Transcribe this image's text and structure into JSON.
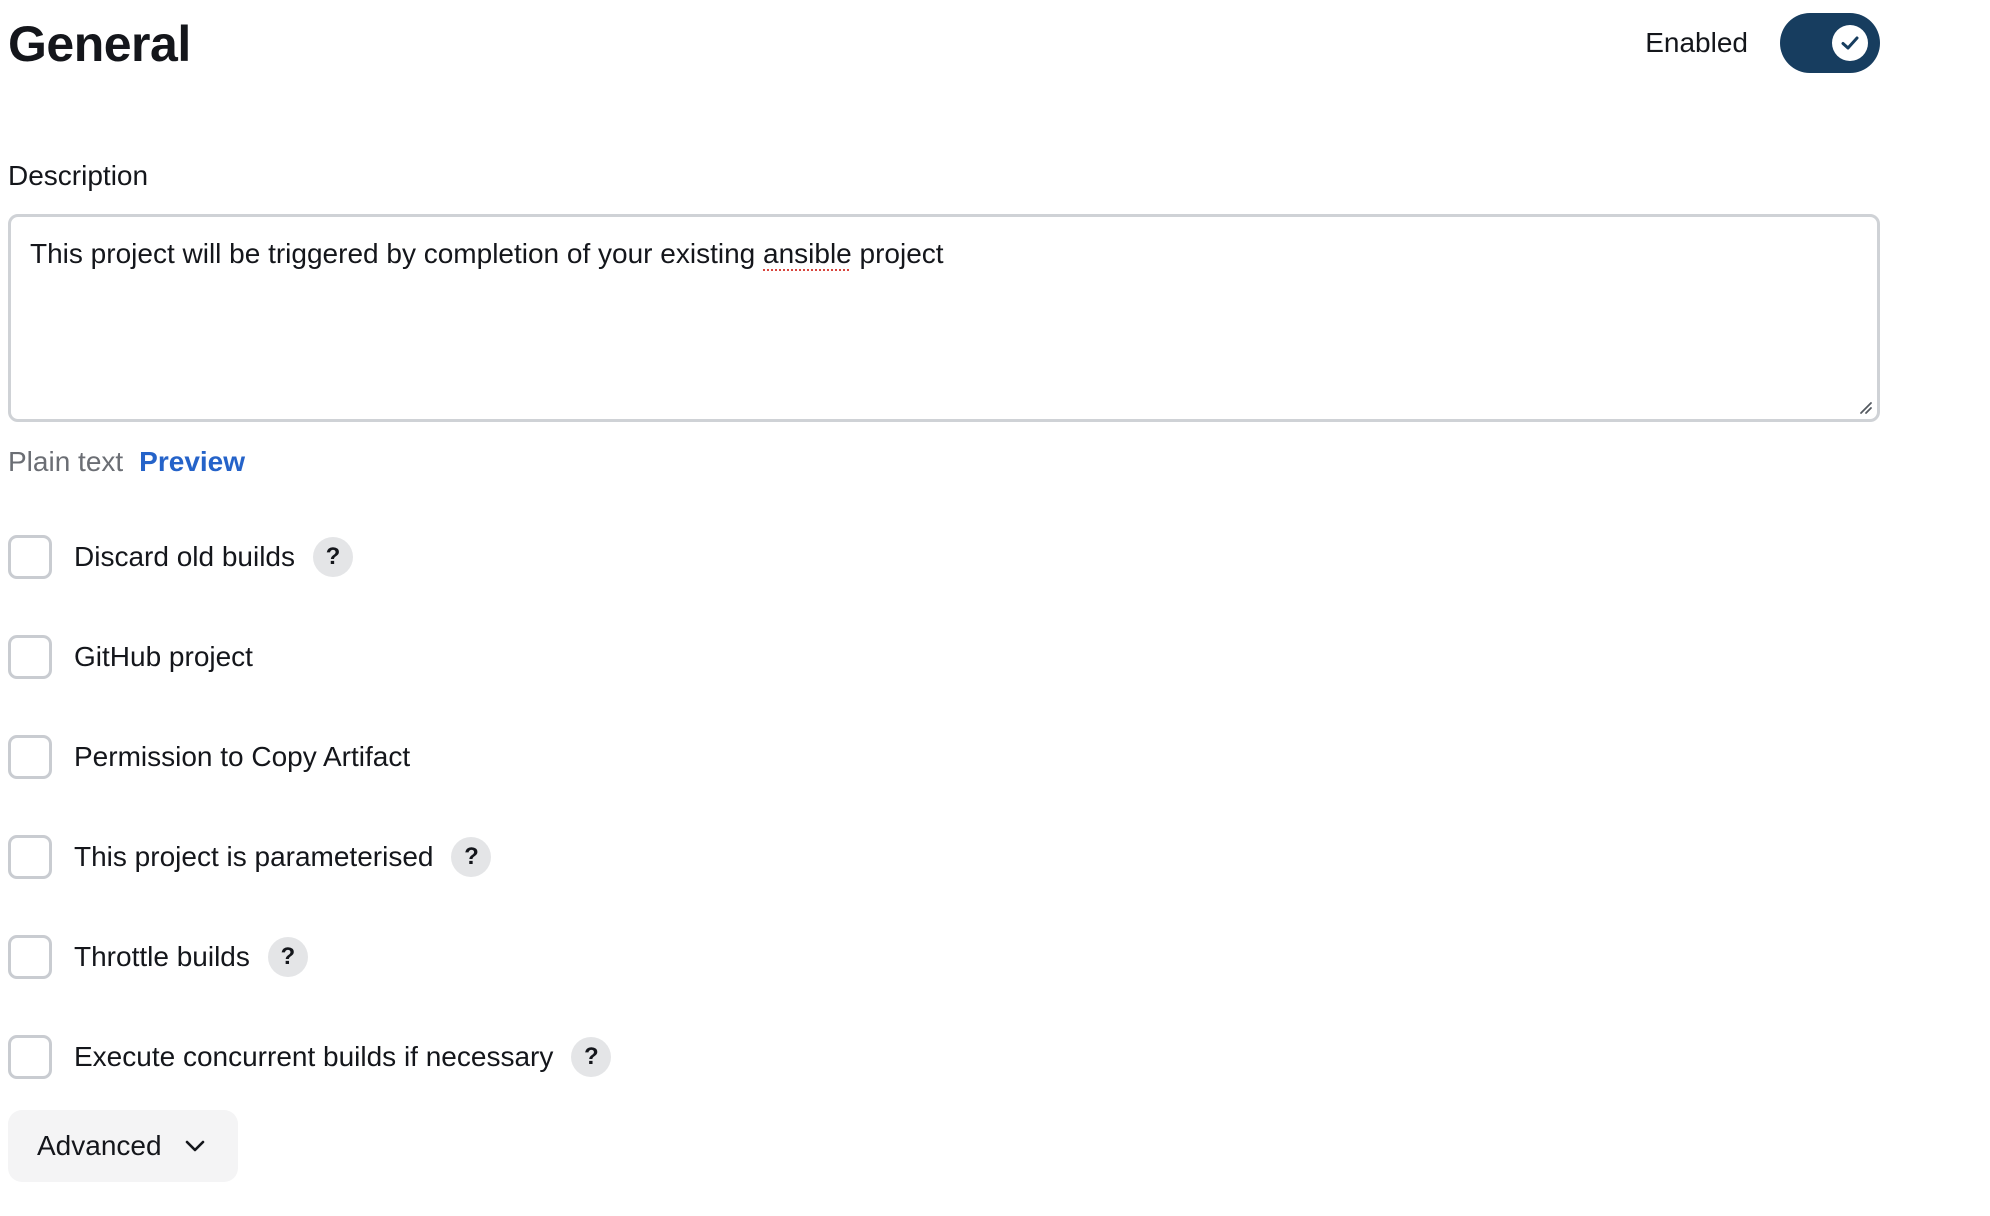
{
  "header": {
    "title": "General",
    "enabled_label": "Enabled",
    "enabled": true
  },
  "description": {
    "label": "Description",
    "text_before": "This project will be triggered by completion of your existing ",
    "misspelled_word": "ansible",
    "text_after": " project"
  },
  "format": {
    "plain_text": "Plain text",
    "preview": "Preview"
  },
  "options": [
    {
      "label": "Discard old builds",
      "checked": false,
      "help": "?"
    },
    {
      "label": "GitHub project",
      "checked": false
    },
    {
      "label": "Permission to Copy Artifact",
      "checked": false
    },
    {
      "label": "This project is parameterised",
      "checked": false,
      "help": "?"
    },
    {
      "label": "Throttle builds",
      "checked": false,
      "help": "?"
    },
    {
      "label": "Execute concurrent builds if necessary",
      "checked": false,
      "help": "?"
    }
  ],
  "advanced": {
    "label": "Advanced"
  },
  "icons": {
    "toggle_check": "check-icon",
    "advanced_chevron": "chevron-down-icon",
    "resize": "resize-grip-icon"
  },
  "colors": {
    "toggle_on": "#173d5f",
    "link": "#2563c9",
    "help_bg": "#e4e5e7"
  }
}
